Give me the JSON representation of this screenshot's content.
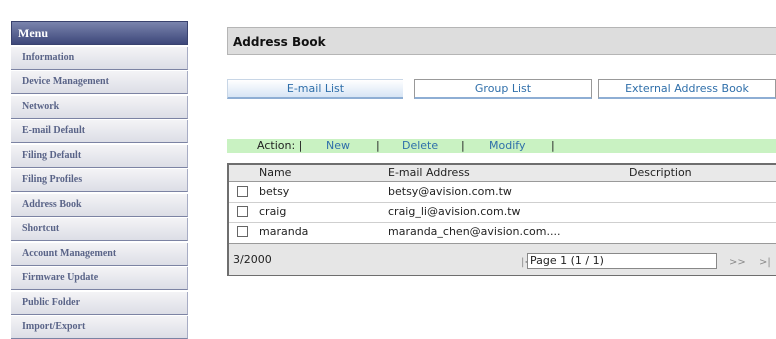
{
  "sidebar": {
    "header": "Menu",
    "items": [
      {
        "label": "Information"
      },
      {
        "label": "Device Management"
      },
      {
        "label": "Network"
      },
      {
        "label": "E-mail Default"
      },
      {
        "label": "Filing Default"
      },
      {
        "label": "Filing Profiles"
      },
      {
        "label": "Address Book"
      },
      {
        "label": "Shortcut"
      },
      {
        "label": "Account Management"
      },
      {
        "label": "Firmware Update"
      },
      {
        "label": "Public Folder"
      },
      {
        "label": "Import/Export"
      }
    ]
  },
  "page": {
    "title": "Address Book"
  },
  "tabs": [
    {
      "label": "E-mail List"
    },
    {
      "label": "Group List"
    },
    {
      "label": "External Address Book"
    }
  ],
  "action_bar": {
    "prefix": "Action: |",
    "new": "New",
    "delete": "Delete",
    "modify": "Modify",
    "sep": "|"
  },
  "table": {
    "columns": [
      "Name",
      "E-mail Address",
      "Description"
    ],
    "rows": [
      {
        "name": "betsy",
        "email": "betsy@avision.com.tw",
        "description": ""
      },
      {
        "name": "craig",
        "email": "craig_li@avision.com.tw",
        "description": ""
      },
      {
        "name": "maranda",
        "email": "maranda_chen@avision.com....",
        "description": ""
      }
    ],
    "footer": {
      "count": "3/2000",
      "first": "|<",
      "prev": "<<",
      "page": "Page 1 (1 / 1)",
      "next": ">>",
      "last": ">|"
    }
  },
  "colors": {
    "menu_header": "#3d477a",
    "action_bar": "#c9f2c2",
    "link": "#2f6faa"
  }
}
